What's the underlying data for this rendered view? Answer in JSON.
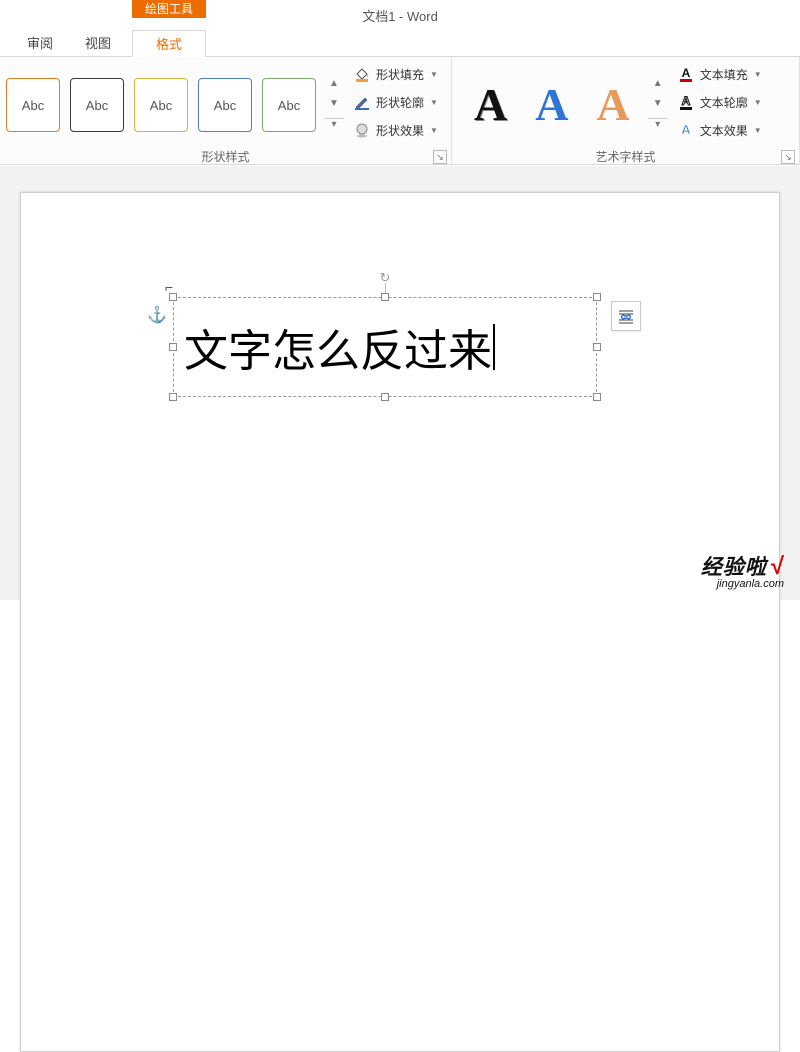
{
  "window_title": "文档1 - Word",
  "context_tab": "绘图工具",
  "tabs": {
    "review": "审阅",
    "view": "视图",
    "format": "格式"
  },
  "groups": {
    "shape_styles": "形状样式",
    "wordart_styles": "艺术字样式"
  },
  "gallery": {
    "sample_label": "Abc",
    "colors": [
      "#e07c24",
      "#3a3a3a",
      "#d4b63c",
      "#4f7fbf",
      "#7fa86a"
    ]
  },
  "shape_menu": {
    "fill": "形状填充",
    "outline": "形状轮廓",
    "effects": "形状效果"
  },
  "wordart": {
    "glyph": "A",
    "colors": [
      "#111111",
      "#2e75d6",
      "#e79a5a"
    ]
  },
  "text_menu": {
    "fill": "文本填充",
    "outline": "文本轮廓",
    "effects": "文本效果"
  },
  "document": {
    "textbox_text": "文字怎么反过来"
  },
  "watermark": {
    "main": "经验啦",
    "sub": "jingyanla.com",
    "check": "√"
  }
}
